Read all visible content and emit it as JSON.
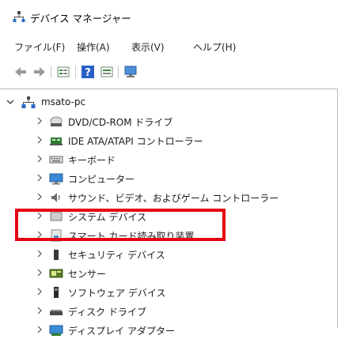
{
  "window": {
    "title": "デバイス マネージャー"
  },
  "menu": [
    {
      "label": "ファイル(F)"
    },
    {
      "label": "操作(A)"
    },
    {
      "label": "表示(V)"
    },
    {
      "label": "ヘルプ(H)"
    }
  ],
  "toolbar": {
    "buttons": [
      "back-icon",
      "forward-icon",
      "properties-icon",
      "help-icon",
      "device-view-icon",
      "monitor-icon"
    ]
  },
  "tree": {
    "root": {
      "label": "msato-pc",
      "expanded": true
    },
    "items": [
      {
        "label": "DVD/CD-ROM ドライブ",
        "icon": "dvd-drive-icon"
      },
      {
        "label": "IDE ATA/ATAPI コントローラー",
        "icon": "ide-controller-icon"
      },
      {
        "label": "キーボード",
        "icon": "keyboard-icon"
      },
      {
        "label": "コンピューター",
        "icon": "computer-icon"
      },
      {
        "label": "サウンド、ビデオ、およびゲーム コントローラー",
        "icon": "speaker-icon"
      },
      {
        "label": "システム デバイス",
        "icon": "system-device-icon"
      },
      {
        "label": "スマート カード読み取り装置",
        "icon": "smart-card-reader-icon"
      },
      {
        "label": "セキュリティ デバイス",
        "icon": "security-device-icon"
      },
      {
        "label": "センサー",
        "icon": "sensor-icon"
      },
      {
        "label": "ソフトウェア デバイス",
        "icon": "software-device-icon"
      },
      {
        "label": "ディスク ドライブ",
        "icon": "disk-drive-icon"
      },
      {
        "label": "ディスプレイ アダプター",
        "icon": "display-adapter-icon"
      }
    ]
  },
  "highlight": {
    "color": "#e60012",
    "target": "スマート カード読み取り装置"
  }
}
